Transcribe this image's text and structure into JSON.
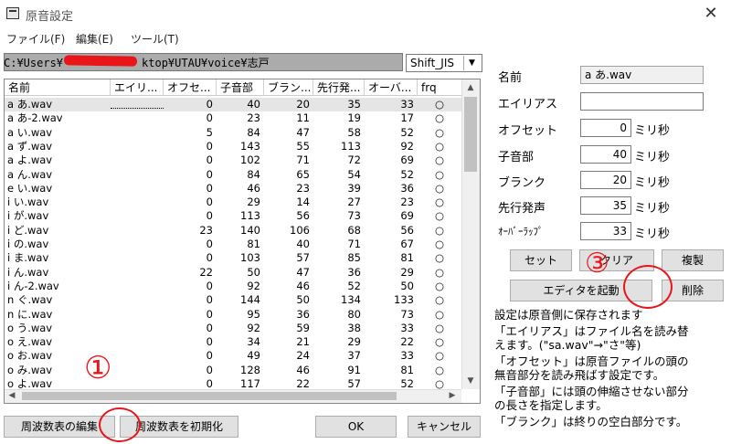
{
  "window": {
    "title": "原音設定",
    "close_glyph": "✕",
    "icon": "app-window-icon"
  },
  "menu": [
    "ファイル(F)",
    "編集(E)",
    "ツール(T)"
  ],
  "path": {
    "prefix": "C:¥Users¥",
    "suffix": "ktop¥UTAU¥voice¥志戸"
  },
  "encoding": {
    "value": "Shift_JIS",
    "arrow": "▼"
  },
  "table": {
    "columns": [
      "名前",
      "エイリ...",
      "オフセ...",
      "子音部",
      "ブラン...",
      "先行発...",
      "オーバ...",
      "frq"
    ],
    "rows": [
      [
        "a あ.wav",
        "",
        "0",
        "40",
        "20",
        "35",
        "33",
        "○"
      ],
      [
        "a あ-2.wav",
        "",
        "0",
        "23",
        "11",
        "19",
        "17",
        "○"
      ],
      [
        "a い.wav",
        "",
        "5",
        "84",
        "47",
        "58",
        "52",
        "○"
      ],
      [
        "a ず.wav",
        "",
        "0",
        "143",
        "55",
        "113",
        "92",
        "○"
      ],
      [
        "a よ.wav",
        "",
        "0",
        "102",
        "71",
        "72",
        "69",
        "○"
      ],
      [
        "a ん.wav",
        "",
        "0",
        "84",
        "65",
        "54",
        "52",
        "○"
      ],
      [
        "e い.wav",
        "",
        "0",
        "46",
        "23",
        "39",
        "36",
        "○"
      ],
      [
        "i い.wav",
        "",
        "0",
        "29",
        "14",
        "27",
        "23",
        "○"
      ],
      [
        "i が.wav",
        "",
        "0",
        "113",
        "56",
        "73",
        "69",
        "○"
      ],
      [
        "i ど.wav",
        "",
        "23",
        "140",
        "106",
        "68",
        "56",
        "○"
      ],
      [
        "i の.wav",
        "",
        "0",
        "81",
        "40",
        "71",
        "67",
        "○"
      ],
      [
        "i ま.wav",
        "",
        "0",
        "103",
        "57",
        "85",
        "81",
        "○"
      ],
      [
        "i ん.wav",
        "",
        "22",
        "50",
        "47",
        "36",
        "29",
        "○"
      ],
      [
        "i ん-2.wav",
        "",
        "0",
        "92",
        "46",
        "52",
        "50",
        "○"
      ],
      [
        "n ぐ.wav",
        "",
        "0",
        "144",
        "50",
        "134",
        "133",
        "○"
      ],
      [
        "n に.wav",
        "",
        "0",
        "95",
        "36",
        "80",
        "73",
        "○"
      ],
      [
        "o う.wav",
        "",
        "0",
        "92",
        "59",
        "38",
        "33",
        "○"
      ],
      [
        "o え.wav",
        "",
        "0",
        "34",
        "21",
        "29",
        "22",
        "○"
      ],
      [
        "o お.wav",
        "",
        "0",
        "49",
        "24",
        "37",
        "33",
        "○"
      ],
      [
        "o み.wav",
        "",
        "0",
        "128",
        "46",
        "91",
        "81",
        "○"
      ],
      [
        "o よ.wav",
        "",
        "0",
        "117",
        "22",
        "57",
        "52",
        "○"
      ]
    ]
  },
  "scroll": {
    "up": "▲",
    "down": "▼",
    "left": "◀",
    "right": "▶"
  },
  "bottom_buttons": {
    "edit_freq": "周波数表の編集",
    "init_freq": "周波数表を初期化",
    "ok": "OK",
    "cancel": "キャンセル"
  },
  "fields": {
    "name": {
      "label": "名前",
      "value": "a あ.wav"
    },
    "alias": {
      "label": "エイリアス",
      "value": ""
    },
    "offset": {
      "label": "オフセット",
      "value": "0",
      "unit": "ミリ秒"
    },
    "consonant": {
      "label": "子音部",
      "value": "40",
      "unit": "ミリ秒"
    },
    "blank": {
      "label": "ブランク",
      "value": "20",
      "unit": "ミリ秒"
    },
    "preutterance": {
      "label": "先行発声",
      "value": "35",
      "unit": "ミリ秒"
    },
    "overlap": {
      "label": "ｵｰﾊﾞｰﾗｯﾌﾟ",
      "value": "33",
      "unit": "ミリ秒"
    }
  },
  "action_buttons": {
    "set": "セット",
    "clear": "クリア",
    "duplicate": "複製",
    "launch_editor": "エディタを起動",
    "delete": "削除"
  },
  "info_lines": [
    "設定は原音側に保存されます",
    "「エイリアス」はファイル名を読み替",
    "えます。(\"sa.wav\"→\"さ\"等)",
    "「オフセット」は原音ファイルの頭の",
    "無音部分を読み飛ばす設定です。",
    "「子音部」には頭の伸縮させない部分",
    "の長さを指定します。",
    "「ブランク」は終りの空白部分です。"
  ],
  "annotations": [
    "①",
    "③"
  ],
  "colors": {
    "annotation": "#e8161b",
    "selected_row": "#e5e5e5",
    "path_bar": "#ababab"
  }
}
